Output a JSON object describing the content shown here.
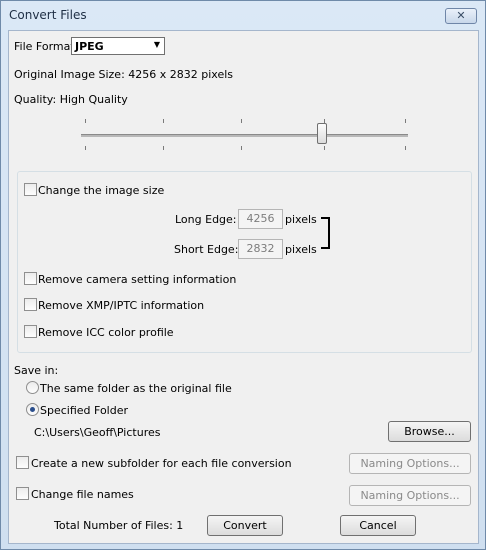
{
  "window": {
    "title": "Convert Files",
    "close_glyph": "✕"
  },
  "file_format": {
    "label": "File Format:",
    "value": "JPEG"
  },
  "original_size": "Original Image Size: 4256 x 2832 pixels",
  "quality": {
    "label": "Quality: High Quality",
    "slider_level": 0.74
  },
  "resize": {
    "label": "Change the image size",
    "long_edge": {
      "label": "Long Edge:",
      "value": "4256",
      "unit": "pixels"
    },
    "short_edge": {
      "label": "Short Edge:",
      "value": "2832",
      "unit": "pixels"
    }
  },
  "options": {
    "remove_camera": "Remove camera setting information",
    "remove_xmp": "Remove XMP/IPTC information",
    "remove_icc": "Remove ICC color profile"
  },
  "save_in": {
    "label": "Save in:",
    "same_folder": "The same folder as the original file",
    "specified": "Specified Folder",
    "path": "C:\\Users\\Geoff\\Pictures",
    "browse": "Browse..."
  },
  "subfolder": {
    "label": "Create a new subfolder for each file conversion",
    "naming": "Naming Options..."
  },
  "filenames": {
    "label": "Change file names",
    "naming": "Naming Options..."
  },
  "total": "Total Number of Files: 1",
  "buttons": {
    "convert": "Convert",
    "cancel": "Cancel"
  }
}
